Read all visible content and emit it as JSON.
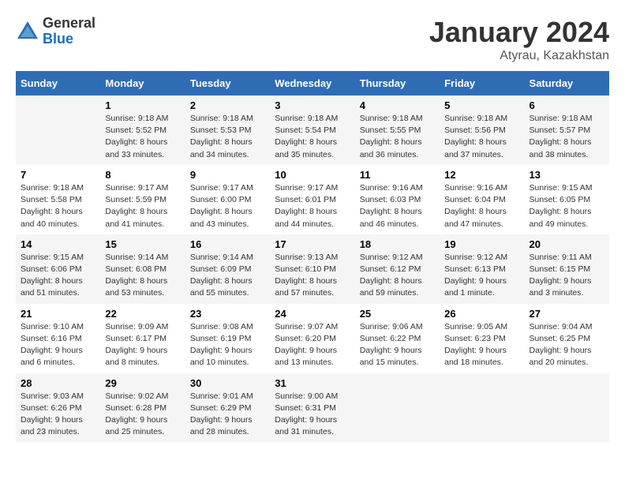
{
  "logo": {
    "general": "General",
    "blue": "Blue"
  },
  "title": "January 2024",
  "location": "Atyrau, Kazakhstan",
  "days_of_week": [
    "Sunday",
    "Monday",
    "Tuesday",
    "Wednesday",
    "Thursday",
    "Friday",
    "Saturday"
  ],
  "weeks": [
    [
      {
        "day": "",
        "info": ""
      },
      {
        "day": "1",
        "info": "Sunrise: 9:18 AM\nSunset: 5:52 PM\nDaylight: 8 hours and 33 minutes."
      },
      {
        "day": "2",
        "info": "Sunrise: 9:18 AM\nSunset: 5:53 PM\nDaylight: 8 hours and 34 minutes."
      },
      {
        "day": "3",
        "info": "Sunrise: 9:18 AM\nSunset: 5:54 PM\nDaylight: 8 hours and 35 minutes."
      },
      {
        "day": "4",
        "info": "Sunrise: 9:18 AM\nSunset: 5:55 PM\nDaylight: 8 hours and 36 minutes."
      },
      {
        "day": "5",
        "info": "Sunrise: 9:18 AM\nSunset: 5:56 PM\nDaylight: 8 hours and 37 minutes."
      },
      {
        "day": "6",
        "info": "Sunrise: 9:18 AM\nSunset: 5:57 PM\nDaylight: 8 hours and 38 minutes."
      }
    ],
    [
      {
        "day": "7",
        "info": "Sunrise: 9:18 AM\nSunset: 5:58 PM\nDaylight: 8 hours and 40 minutes."
      },
      {
        "day": "8",
        "info": "Sunrise: 9:17 AM\nSunset: 5:59 PM\nDaylight: 8 hours and 41 minutes."
      },
      {
        "day": "9",
        "info": "Sunrise: 9:17 AM\nSunset: 6:00 PM\nDaylight: 8 hours and 43 minutes."
      },
      {
        "day": "10",
        "info": "Sunrise: 9:17 AM\nSunset: 6:01 PM\nDaylight: 8 hours and 44 minutes."
      },
      {
        "day": "11",
        "info": "Sunrise: 9:16 AM\nSunset: 6:03 PM\nDaylight: 8 hours and 46 minutes."
      },
      {
        "day": "12",
        "info": "Sunrise: 9:16 AM\nSunset: 6:04 PM\nDaylight: 8 hours and 47 minutes."
      },
      {
        "day": "13",
        "info": "Sunrise: 9:15 AM\nSunset: 6:05 PM\nDaylight: 8 hours and 49 minutes."
      }
    ],
    [
      {
        "day": "14",
        "info": "Sunrise: 9:15 AM\nSunset: 6:06 PM\nDaylight: 8 hours and 51 minutes."
      },
      {
        "day": "15",
        "info": "Sunrise: 9:14 AM\nSunset: 6:08 PM\nDaylight: 8 hours and 53 minutes."
      },
      {
        "day": "16",
        "info": "Sunrise: 9:14 AM\nSunset: 6:09 PM\nDaylight: 8 hours and 55 minutes."
      },
      {
        "day": "17",
        "info": "Sunrise: 9:13 AM\nSunset: 6:10 PM\nDaylight: 8 hours and 57 minutes."
      },
      {
        "day": "18",
        "info": "Sunrise: 9:12 AM\nSunset: 6:12 PM\nDaylight: 8 hours and 59 minutes."
      },
      {
        "day": "19",
        "info": "Sunrise: 9:12 AM\nSunset: 6:13 PM\nDaylight: 9 hours and 1 minute."
      },
      {
        "day": "20",
        "info": "Sunrise: 9:11 AM\nSunset: 6:15 PM\nDaylight: 9 hours and 3 minutes."
      }
    ],
    [
      {
        "day": "21",
        "info": "Sunrise: 9:10 AM\nSunset: 6:16 PM\nDaylight: 9 hours and 6 minutes."
      },
      {
        "day": "22",
        "info": "Sunrise: 9:09 AM\nSunset: 6:17 PM\nDaylight: 9 hours and 8 minutes."
      },
      {
        "day": "23",
        "info": "Sunrise: 9:08 AM\nSunset: 6:19 PM\nDaylight: 9 hours and 10 minutes."
      },
      {
        "day": "24",
        "info": "Sunrise: 9:07 AM\nSunset: 6:20 PM\nDaylight: 9 hours and 13 minutes."
      },
      {
        "day": "25",
        "info": "Sunrise: 9:06 AM\nSunset: 6:22 PM\nDaylight: 9 hours and 15 minutes."
      },
      {
        "day": "26",
        "info": "Sunrise: 9:05 AM\nSunset: 6:23 PM\nDaylight: 9 hours and 18 minutes."
      },
      {
        "day": "27",
        "info": "Sunrise: 9:04 AM\nSunset: 6:25 PM\nDaylight: 9 hours and 20 minutes."
      }
    ],
    [
      {
        "day": "28",
        "info": "Sunrise: 9:03 AM\nSunset: 6:26 PM\nDaylight: 9 hours and 23 minutes."
      },
      {
        "day": "29",
        "info": "Sunrise: 9:02 AM\nSunset: 6:28 PM\nDaylight: 9 hours and 25 minutes."
      },
      {
        "day": "30",
        "info": "Sunrise: 9:01 AM\nSunset: 6:29 PM\nDaylight: 9 hours and 28 minutes."
      },
      {
        "day": "31",
        "info": "Sunrise: 9:00 AM\nSunset: 6:31 PM\nDaylight: 9 hours and 31 minutes."
      },
      {
        "day": "",
        "info": ""
      },
      {
        "day": "",
        "info": ""
      },
      {
        "day": "",
        "info": ""
      }
    ]
  ]
}
